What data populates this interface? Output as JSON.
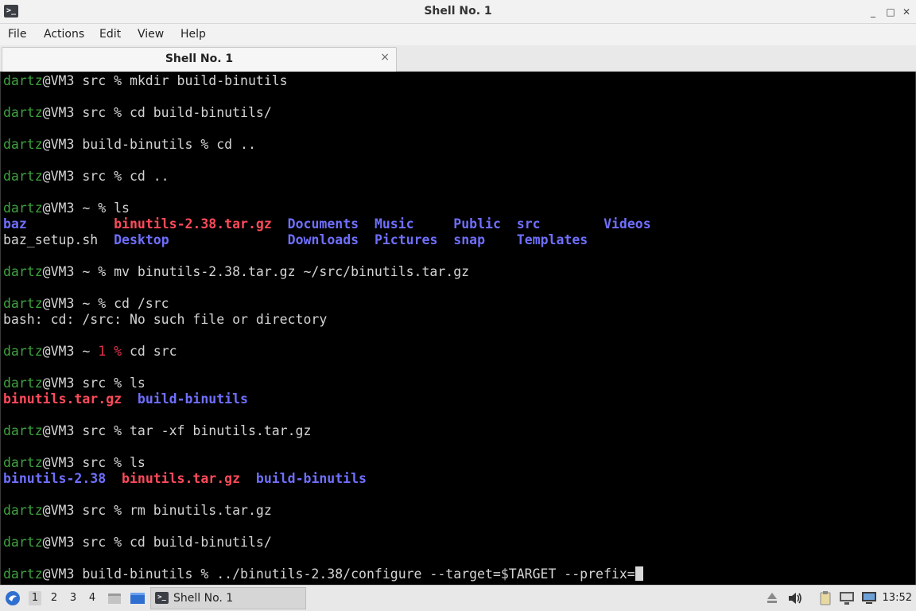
{
  "window": {
    "title": "Shell No. 1",
    "app_icon": "terminal-icon",
    "controls": {
      "minimize": "_",
      "maximize": "□",
      "close": "✕"
    }
  },
  "menu": [
    "File",
    "Actions",
    "Edit",
    "View",
    "Help"
  ],
  "tab": {
    "label": "Shell No. 1",
    "close": "×"
  },
  "terminal_lines": [
    [
      {
        "t": "dartz",
        "c": "user"
      },
      {
        "t": "@VM3 src % mkdir build-binutils",
        "c": "host"
      }
    ],
    [
      {
        "t": "dartz",
        "c": "user"
      },
      {
        "t": "@VM3 src % cd build-binutils/",
        "c": "host"
      }
    ],
    [
      {
        "t": "dartz",
        "c": "user"
      },
      {
        "t": "@VM3 build-binutils % cd ..",
        "c": "host"
      }
    ],
    [
      {
        "t": "dartz",
        "c": "user"
      },
      {
        "t": "@VM3 src % cd ..",
        "c": "host"
      }
    ],
    [
      {
        "t": "dartz",
        "c": "user"
      },
      {
        "t": "@VM3 ~ % ls",
        "c": "host"
      }
    ],
    [
      {
        "t": "baz",
        "c": "dir"
      },
      {
        "t": "           ",
        "c": "plain"
      },
      {
        "t": "binutils-2.38.tar.gz",
        "c": "tar"
      },
      {
        "t": "  ",
        "c": "plain"
      },
      {
        "t": "Documents",
        "c": "dir"
      },
      {
        "t": "  ",
        "c": "plain"
      },
      {
        "t": "Music",
        "c": "dir"
      },
      {
        "t": "     ",
        "c": "plain"
      },
      {
        "t": "Public",
        "c": "dir"
      },
      {
        "t": "  ",
        "c": "plain"
      },
      {
        "t": "src",
        "c": "dir"
      },
      {
        "t": "        ",
        "c": "plain"
      },
      {
        "t": "Videos",
        "c": "dir"
      }
    ],
    [
      {
        "t": "baz_setup.sh",
        "c": "plain"
      },
      {
        "t": "  ",
        "c": "plain"
      },
      {
        "t": "Desktop",
        "c": "dir"
      },
      {
        "t": "               ",
        "c": "plain"
      },
      {
        "t": "Downloads",
        "c": "dir"
      },
      {
        "t": "  ",
        "c": "plain"
      },
      {
        "t": "Pictures",
        "c": "dir"
      },
      {
        "t": "  ",
        "c": "plain"
      },
      {
        "t": "snap",
        "c": "dir"
      },
      {
        "t": "    ",
        "c": "plain"
      },
      {
        "t": "Templates",
        "c": "dir"
      }
    ],
    [
      {
        "t": "dartz",
        "c": "user"
      },
      {
        "t": "@VM3 ~ % mv binutils-2.38.tar.gz ~/src/binutils.tar.gz",
        "c": "host"
      }
    ],
    [
      {
        "t": "dartz",
        "c": "user"
      },
      {
        "t": "@VM3 ~ % cd /src",
        "c": "host"
      }
    ],
    [
      {
        "t": "bash: cd: /src: No such file or directory",
        "c": "plain"
      }
    ],
    [
      {
        "t": "dartz",
        "c": "user"
      },
      {
        "t": "@VM3 ~ ",
        "c": "host"
      },
      {
        "t": "1 %",
        "c": "err"
      },
      {
        "t": " cd src",
        "c": "host"
      }
    ],
    [
      {
        "t": "dartz",
        "c": "user"
      },
      {
        "t": "@VM3 src % ls",
        "c": "host"
      }
    ],
    [
      {
        "t": "binutils.tar.gz",
        "c": "tar"
      },
      {
        "t": "  ",
        "c": "plain"
      },
      {
        "t": "build-binutils",
        "c": "dir"
      }
    ],
    [
      {
        "t": "dartz",
        "c": "user"
      },
      {
        "t": "@VM3 src % tar -xf binutils.tar.gz",
        "c": "host"
      }
    ],
    [
      {
        "t": "dartz",
        "c": "user"
      },
      {
        "t": "@VM3 src % ls",
        "c": "host"
      }
    ],
    [
      {
        "t": "binutils-2.38",
        "c": "dir"
      },
      {
        "t": "  ",
        "c": "plain"
      },
      {
        "t": "binutils.tar.gz",
        "c": "tar"
      },
      {
        "t": "  ",
        "c": "plain"
      },
      {
        "t": "build-binutils",
        "c": "dir"
      }
    ],
    [
      {
        "t": "dartz",
        "c": "user"
      },
      {
        "t": "@VM3 src % rm binutils.tar.gz",
        "c": "host"
      }
    ],
    [
      {
        "t": "dartz",
        "c": "user"
      },
      {
        "t": "@VM3 src % cd build-binutils/",
        "c": "host"
      }
    ],
    [
      {
        "t": "dartz",
        "c": "user"
      },
      {
        "t": "@VM3 build-binutils % ../binutils-2.38/configure --target=$TARGET --prefix=",
        "c": "host"
      },
      {
        "t": "",
        "c": "cursor"
      }
    ]
  ],
  "taskbar": {
    "start_icon": "start-menu-icon",
    "workspaces": [
      "1",
      "2",
      "3",
      "4"
    ],
    "active_workspace": "1",
    "task_label": "Shell No. 1",
    "tray_icons": [
      "eject-icon",
      "volume-icon",
      "clipboard-icon",
      "network-icon",
      "display-icon"
    ],
    "clock": "13:52"
  },
  "colors": {
    "prompt_user": "#3ea23e",
    "directory": "#6f6fff",
    "archive": "#ff4a5a",
    "error_code": "#e0314b",
    "terminal_bg": "#000000"
  }
}
